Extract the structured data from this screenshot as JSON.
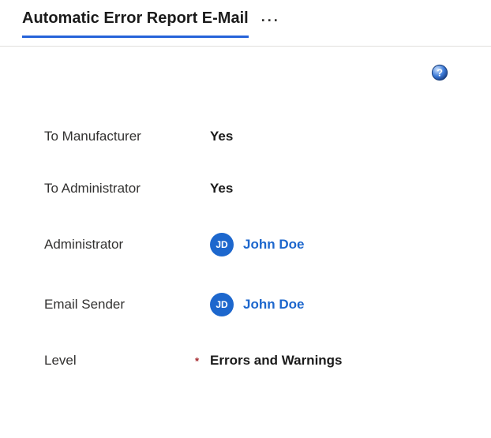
{
  "header": {
    "title": "Automatic Error Report E-Mail",
    "more_label": "···"
  },
  "help": {
    "icon_name": "help-icon"
  },
  "fields": {
    "to_manufacturer": {
      "label": "To Manufacturer",
      "value": "Yes",
      "required": false
    },
    "to_administrator": {
      "label": "To Administrator",
      "value": "Yes",
      "required": false
    },
    "administrator": {
      "label": "Administrator",
      "person": {
        "initials": "JD",
        "name": "John Doe"
      },
      "required": false
    },
    "email_sender": {
      "label": "Email Sender",
      "person": {
        "initials": "JD",
        "name": "John Doe"
      },
      "required": false
    },
    "level": {
      "label": "Level",
      "value": "Errors and Warnings",
      "required": true,
      "required_mark": "*"
    }
  },
  "colors": {
    "accent": "#2563d9",
    "link": "#1d67cd",
    "required": "#a4262c"
  }
}
